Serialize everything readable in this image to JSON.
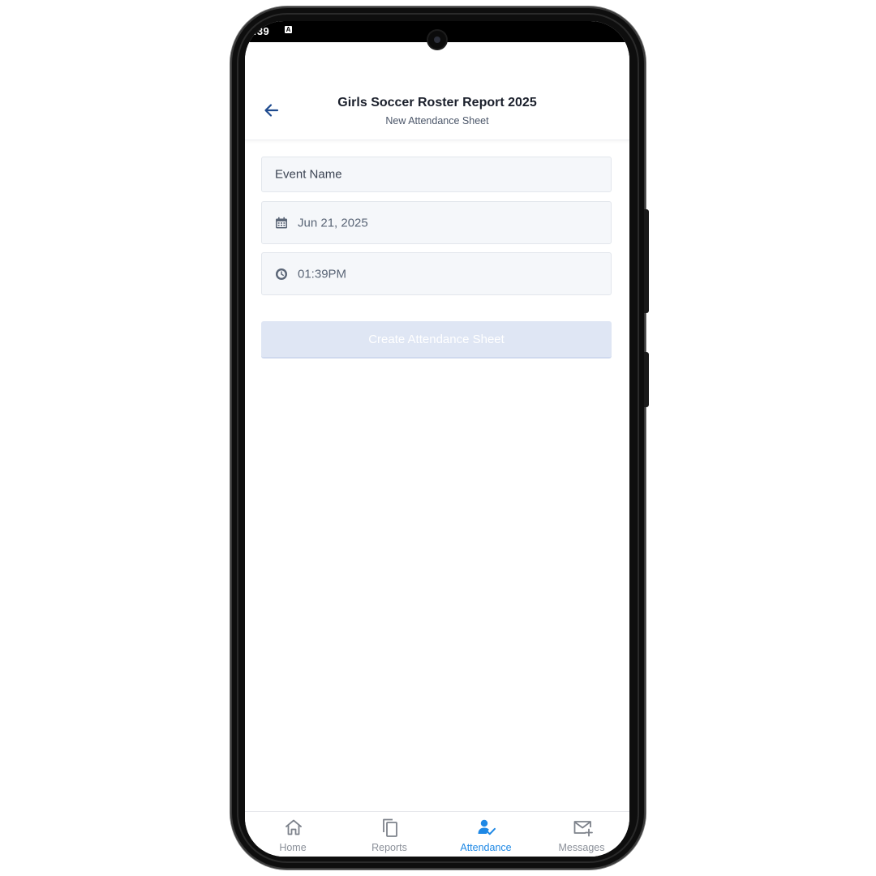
{
  "status_bar": {
    "time": ":39",
    "notification_icon": "A"
  },
  "header": {
    "back_icon": "arrow-left-icon",
    "title": "Girls Soccer Roster Report 2025",
    "subtitle": "New Attendance Sheet"
  },
  "form": {
    "event_name_placeholder": "Event Name",
    "date_value": "Jun 21, 2025",
    "date_icon": "calendar-icon",
    "time_value": "01:39PM",
    "time_icon": "clock-icon",
    "submit_label": "Create Attendance Sheet",
    "submit_enabled": false
  },
  "bottom_nav": {
    "items": [
      {
        "label": "Home",
        "icon": "home-icon",
        "active": false
      },
      {
        "label": "Reports",
        "icon": "copy-icon",
        "active": false
      },
      {
        "label": "Attendance",
        "icon": "person-check-icon",
        "active": true
      },
      {
        "label": "Messages",
        "icon": "mail-plus-icon",
        "active": false
      }
    ]
  },
  "colors": {
    "accent": "#1e88e5",
    "back_arrow": "#1f4b8f",
    "button_disabled_bg": "#dfe6f4",
    "field_bg": "#f5f7fa",
    "nav_inactive": "#8a8f98"
  }
}
